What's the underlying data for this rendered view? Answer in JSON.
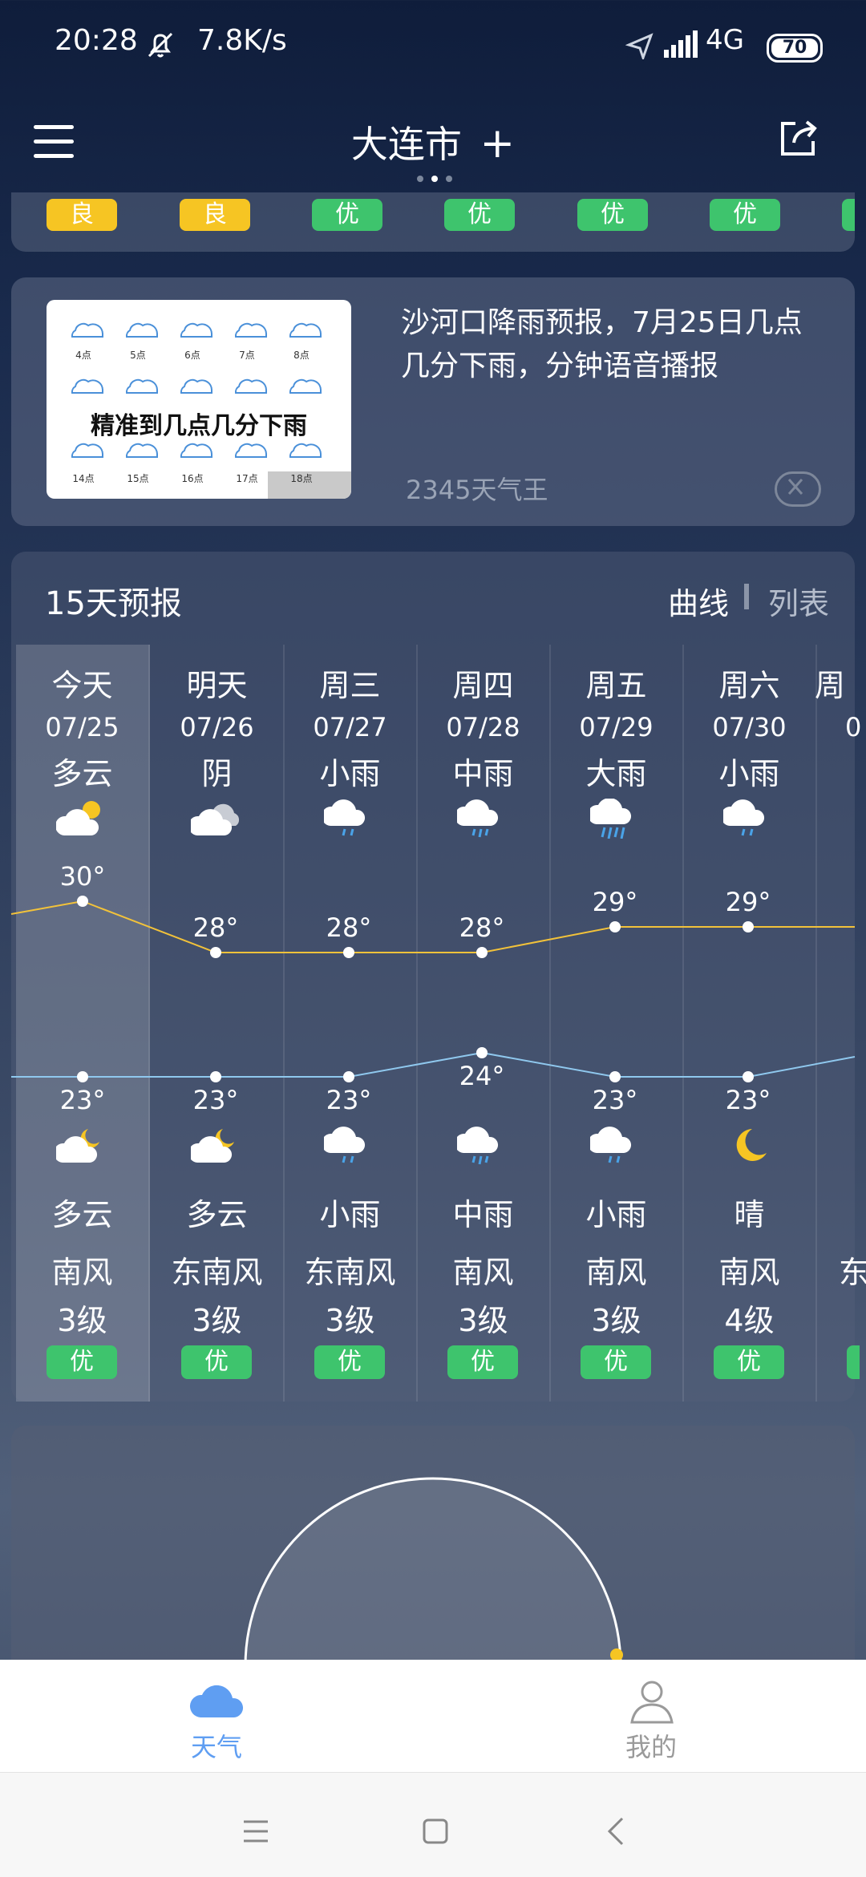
{
  "status_bar": {
    "time": "20:28",
    "net_speed": "7.8K/s",
    "network": "4G",
    "battery": "70",
    "icons": [
      "alarm-off-icon",
      "location-icon",
      "signal-icon"
    ]
  },
  "header": {
    "city": "大连市",
    "add_icon": "+",
    "share_icon": "share-icon",
    "menu_icon": "menu-icon"
  },
  "aqi_strip": [
    "良",
    "良",
    "优",
    "优",
    "优",
    "优"
  ],
  "ad": {
    "title": "沙河口降雨预报，7月25日几点几分下雨，分钟语音播报",
    "source": "2345天气王",
    "image_banner": "精准到几点几分下雨",
    "image_times": [
      "4点",
      "5点",
      "6点",
      "7点",
      "8点",
      "14点",
      "15点",
      "16点",
      "17点",
      "18点"
    ]
  },
  "forecast": {
    "title": "15天预报",
    "view_curve": "曲线",
    "view_list": "列表",
    "days": [
      {
        "day": "今天",
        "date": "07/25",
        "day_cond": "多云",
        "high": "30°",
        "low": "23°",
        "night_cond": "多云",
        "wind_dir": "南风",
        "wind_level": "3级",
        "aqi": "优",
        "day_icon": "partly-cloudy-icon",
        "night_icon": "cloudy-night-icon"
      },
      {
        "day": "明天",
        "date": "07/26",
        "day_cond": "阴",
        "high": "28°",
        "low": "23°",
        "night_cond": "多云",
        "wind_dir": "东南风",
        "wind_level": "3级",
        "aqi": "优",
        "day_icon": "overcast-icon",
        "night_icon": "cloudy-night-icon"
      },
      {
        "day": "周三",
        "date": "07/27",
        "day_cond": "小雨",
        "high": "28°",
        "low": "23°",
        "night_cond": "小雨",
        "wind_dir": "东南风",
        "wind_level": "3级",
        "aqi": "优",
        "day_icon": "light-rain-icon",
        "night_icon": "light-rain-icon"
      },
      {
        "day": "周四",
        "date": "07/28",
        "day_cond": "中雨",
        "high": "28°",
        "low": "24°",
        "night_cond": "中雨",
        "wind_dir": "南风",
        "wind_level": "3级",
        "aqi": "优",
        "day_icon": "moderate-rain-icon",
        "night_icon": "moderate-rain-icon"
      },
      {
        "day": "周五",
        "date": "07/29",
        "day_cond": "大雨",
        "high": "29°",
        "low": "23°",
        "night_cond": "小雨",
        "wind_dir": "南风",
        "wind_level": "3级",
        "aqi": "优",
        "day_icon": "heavy-rain-icon",
        "night_icon": "light-rain-icon"
      },
      {
        "day": "周六",
        "date": "07/30",
        "day_cond": "小雨",
        "high": "29°",
        "low": "23°",
        "night_cond": "晴",
        "wind_dir": "南风",
        "wind_level": "4级",
        "aqi": "优",
        "day_icon": "light-rain-icon",
        "night_icon": "moon-icon"
      }
    ],
    "partial_next": {
      "day": "周",
      "date": "0",
      "wind_dir": "东"
    }
  },
  "bottom_nav": {
    "weather_label": "天气",
    "mine_label": "我的"
  },
  "colors": {
    "accent_blue": "#5f9ef2",
    "aqi_good": "#3ec46d",
    "aqi_moderate": "#f6c523",
    "high_line": "#f2c23a",
    "low_line": "#8fc8ee"
  }
}
